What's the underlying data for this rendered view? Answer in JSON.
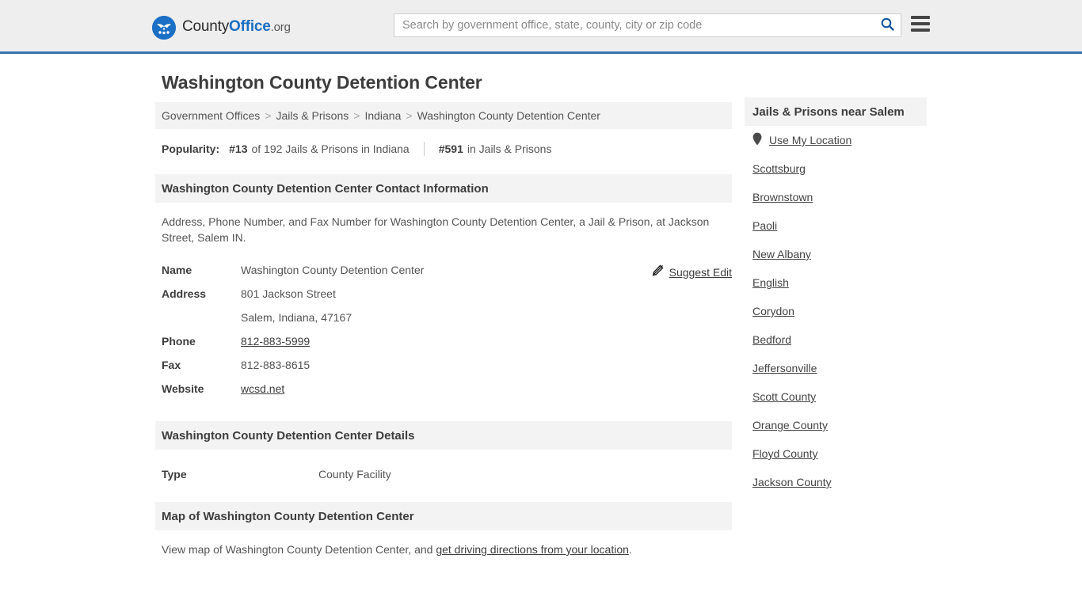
{
  "header": {
    "brand": {
      "logo_icon": "eagle-shield-icon",
      "text_county": "County",
      "text_office": "Office",
      "text_org": ".org"
    },
    "search": {
      "placeholder": "Search by government office, state, county, city or zip code",
      "value": "",
      "search_icon": "search-icon"
    },
    "menu_icon": "hamburger-menu-icon",
    "accent_color": "#3b74ab",
    "background_color": "#eeeeee"
  },
  "main": {
    "title": "Washington County Detention Center",
    "breadcrumb": {
      "items": [
        {
          "label": "Government Offices"
        },
        {
          "label": "Jails & Prisons"
        },
        {
          "label": "Indiana"
        }
      ],
      "separator": ">",
      "current": "Washington County Detention Center"
    },
    "popularity": {
      "label": "Popularity:",
      "rank_state": "#13",
      "rank_state_text": "of 192 Jails & Prisons in Indiana",
      "rank_national": "#591",
      "rank_national_text": "in Jails & Prisons"
    },
    "contact_section": {
      "heading": "Washington County Detention Center Contact Information",
      "description": "Address, Phone Number, and Fax Number for Washington County Detention Center, a Jail & Prison, at Jackson Street, Salem IN.",
      "suggest_edit": {
        "label": "Suggest Edit",
        "icon": "edit-pencil-icon"
      },
      "rows": [
        {
          "key": "Name",
          "value": "Washington County Detention Center",
          "link": false
        },
        {
          "key": "Address",
          "value": "801 Jackson Street",
          "link": false
        },
        {
          "key": "",
          "value": "Salem, Indiana, 47167",
          "link": false
        },
        {
          "key": "Phone",
          "value": "812-883-5999",
          "link": true
        },
        {
          "key": "Fax",
          "value": "812-883-8615",
          "link": false
        },
        {
          "key": "Website",
          "value": "wcsd.net",
          "link": true
        }
      ]
    },
    "details_section": {
      "heading": "Washington County Detention Center Details",
      "rows": [
        {
          "key": "Type",
          "value": "County Facility"
        }
      ]
    },
    "map_section": {
      "heading": "Map of Washington County Detention Center",
      "description_prefix": "View map of Washington County Detention Center, and ",
      "description_link": "get driving directions from your location",
      "description_suffix": "."
    }
  },
  "sidebar": {
    "title": "Jails & Prisons near Salem",
    "locate": {
      "icon": "map-pin-icon",
      "label": "Use My Location"
    },
    "items": [
      {
        "label": "Scottsburg"
      },
      {
        "label": "Brownstown"
      },
      {
        "label": "Paoli"
      },
      {
        "label": "New Albany"
      },
      {
        "label": "English"
      },
      {
        "label": "Corydon"
      },
      {
        "label": "Bedford"
      },
      {
        "label": "Jeffersonville"
      },
      {
        "label": "Scott County"
      },
      {
        "label": "Orange County"
      },
      {
        "label": "Floyd County"
      },
      {
        "label": "Jackson County"
      }
    ]
  }
}
